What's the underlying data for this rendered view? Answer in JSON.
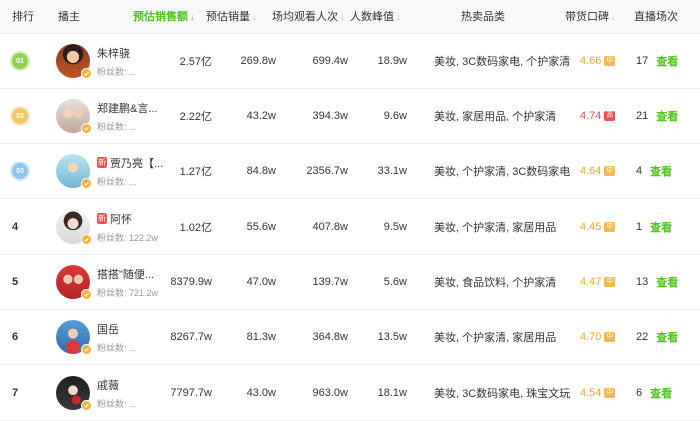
{
  "header": {
    "rank": "排行",
    "anchor": "播主",
    "sales_amount": "预估销售额",
    "sales_volume": "预估销量",
    "viewers": "场均观看人次",
    "peak": "人数峰值",
    "categories": "热卖品类",
    "reputation": "带货口碑",
    "sessions": "直播场次"
  },
  "colors": {
    "accent": "#52c41a",
    "score": "#f5a623",
    "score_high": "#f5504f"
  },
  "rows": [
    {
      "rank": "01",
      "medal": "1",
      "name": "朱梓骁",
      "fans_label": "粉丝数:",
      "fans_value": "...",
      "is_new": false,
      "sales_amount": "2.57亿",
      "sales_volume": "269.8w",
      "viewers": "699.4w",
      "peak": "18.9w",
      "categories": "美妆, 3C数码家电, 个护家清",
      "score": "4.66",
      "score_badge": "中",
      "score_high": false,
      "sessions": "17",
      "view": "查看"
    },
    {
      "rank": "02",
      "medal": "2",
      "name": "郑建鹏&言...",
      "fans_label": "粉丝数:",
      "fans_value": "...",
      "is_new": false,
      "sales_amount": "2.22亿",
      "sales_volume": "43.2w",
      "viewers": "394.3w",
      "peak": "9.6w",
      "categories": "美妆, 家居用品, 个护家清",
      "score": "4.74",
      "score_badge": "高",
      "score_high": true,
      "sessions": "21",
      "view": "查看"
    },
    {
      "rank": "03",
      "medal": "3",
      "name": "贾乃亮【...",
      "fans_label": "粉丝数:",
      "fans_value": "...",
      "is_new": true,
      "new_label": "新",
      "sales_amount": "1.27亿",
      "sales_volume": "84.8w",
      "viewers": "2356.7w",
      "peak": "33.1w",
      "categories": "美妆, 个护家清, 3C数码家电",
      "score": "4.64",
      "score_badge": "中",
      "score_high": false,
      "sessions": "4",
      "view": "查看"
    },
    {
      "rank": "4",
      "medal": "",
      "name": "阿怀",
      "fans_label": "粉丝数:",
      "fans_value": "122.2w",
      "is_new": true,
      "new_label": "新",
      "sales_amount": "1.02亿",
      "sales_volume": "55.6w",
      "viewers": "407.8w",
      "peak": "9.5w",
      "categories": "美妆, 个护家清, 家居用品",
      "score": "4.45",
      "score_badge": "中",
      "score_high": false,
      "sessions": "1",
      "view": "查看"
    },
    {
      "rank": "5",
      "medal": "",
      "name": "搭搭\"随便...",
      "fans_label": "粉丝数:",
      "fans_value": "721.2w",
      "is_new": false,
      "sales_amount": "8379.9w",
      "sales_volume": "47.0w",
      "viewers": "139.7w",
      "peak": "5.6w",
      "categories": "美妆, 食品饮料, 个护家清",
      "score": "4.47",
      "score_badge": "中",
      "score_high": false,
      "sessions": "13",
      "view": "查看"
    },
    {
      "rank": "6",
      "medal": "",
      "name": "国岳",
      "fans_label": "粉丝数:",
      "fans_value": "...",
      "is_new": false,
      "sales_amount": "8267.7w",
      "sales_volume": "81.3w",
      "viewers": "364.8w",
      "peak": "13.5w",
      "categories": "美妆, 个护家清, 家居用品",
      "score": "4.70",
      "score_badge": "中",
      "score_high": false,
      "sessions": "22",
      "view": "查看"
    },
    {
      "rank": "7",
      "medal": "",
      "name": "戚薇",
      "fans_label": "粉丝数:",
      "fans_value": "...",
      "is_new": false,
      "sales_amount": "7797.7w",
      "sales_volume": "43.0w",
      "viewers": "963.0w",
      "peak": "18.1w",
      "categories": "美妆, 3C数码家电, 珠宝文玩",
      "score": "4.54",
      "score_badge": "中",
      "score_high": false,
      "sessions": "6",
      "view": "查看"
    }
  ]
}
